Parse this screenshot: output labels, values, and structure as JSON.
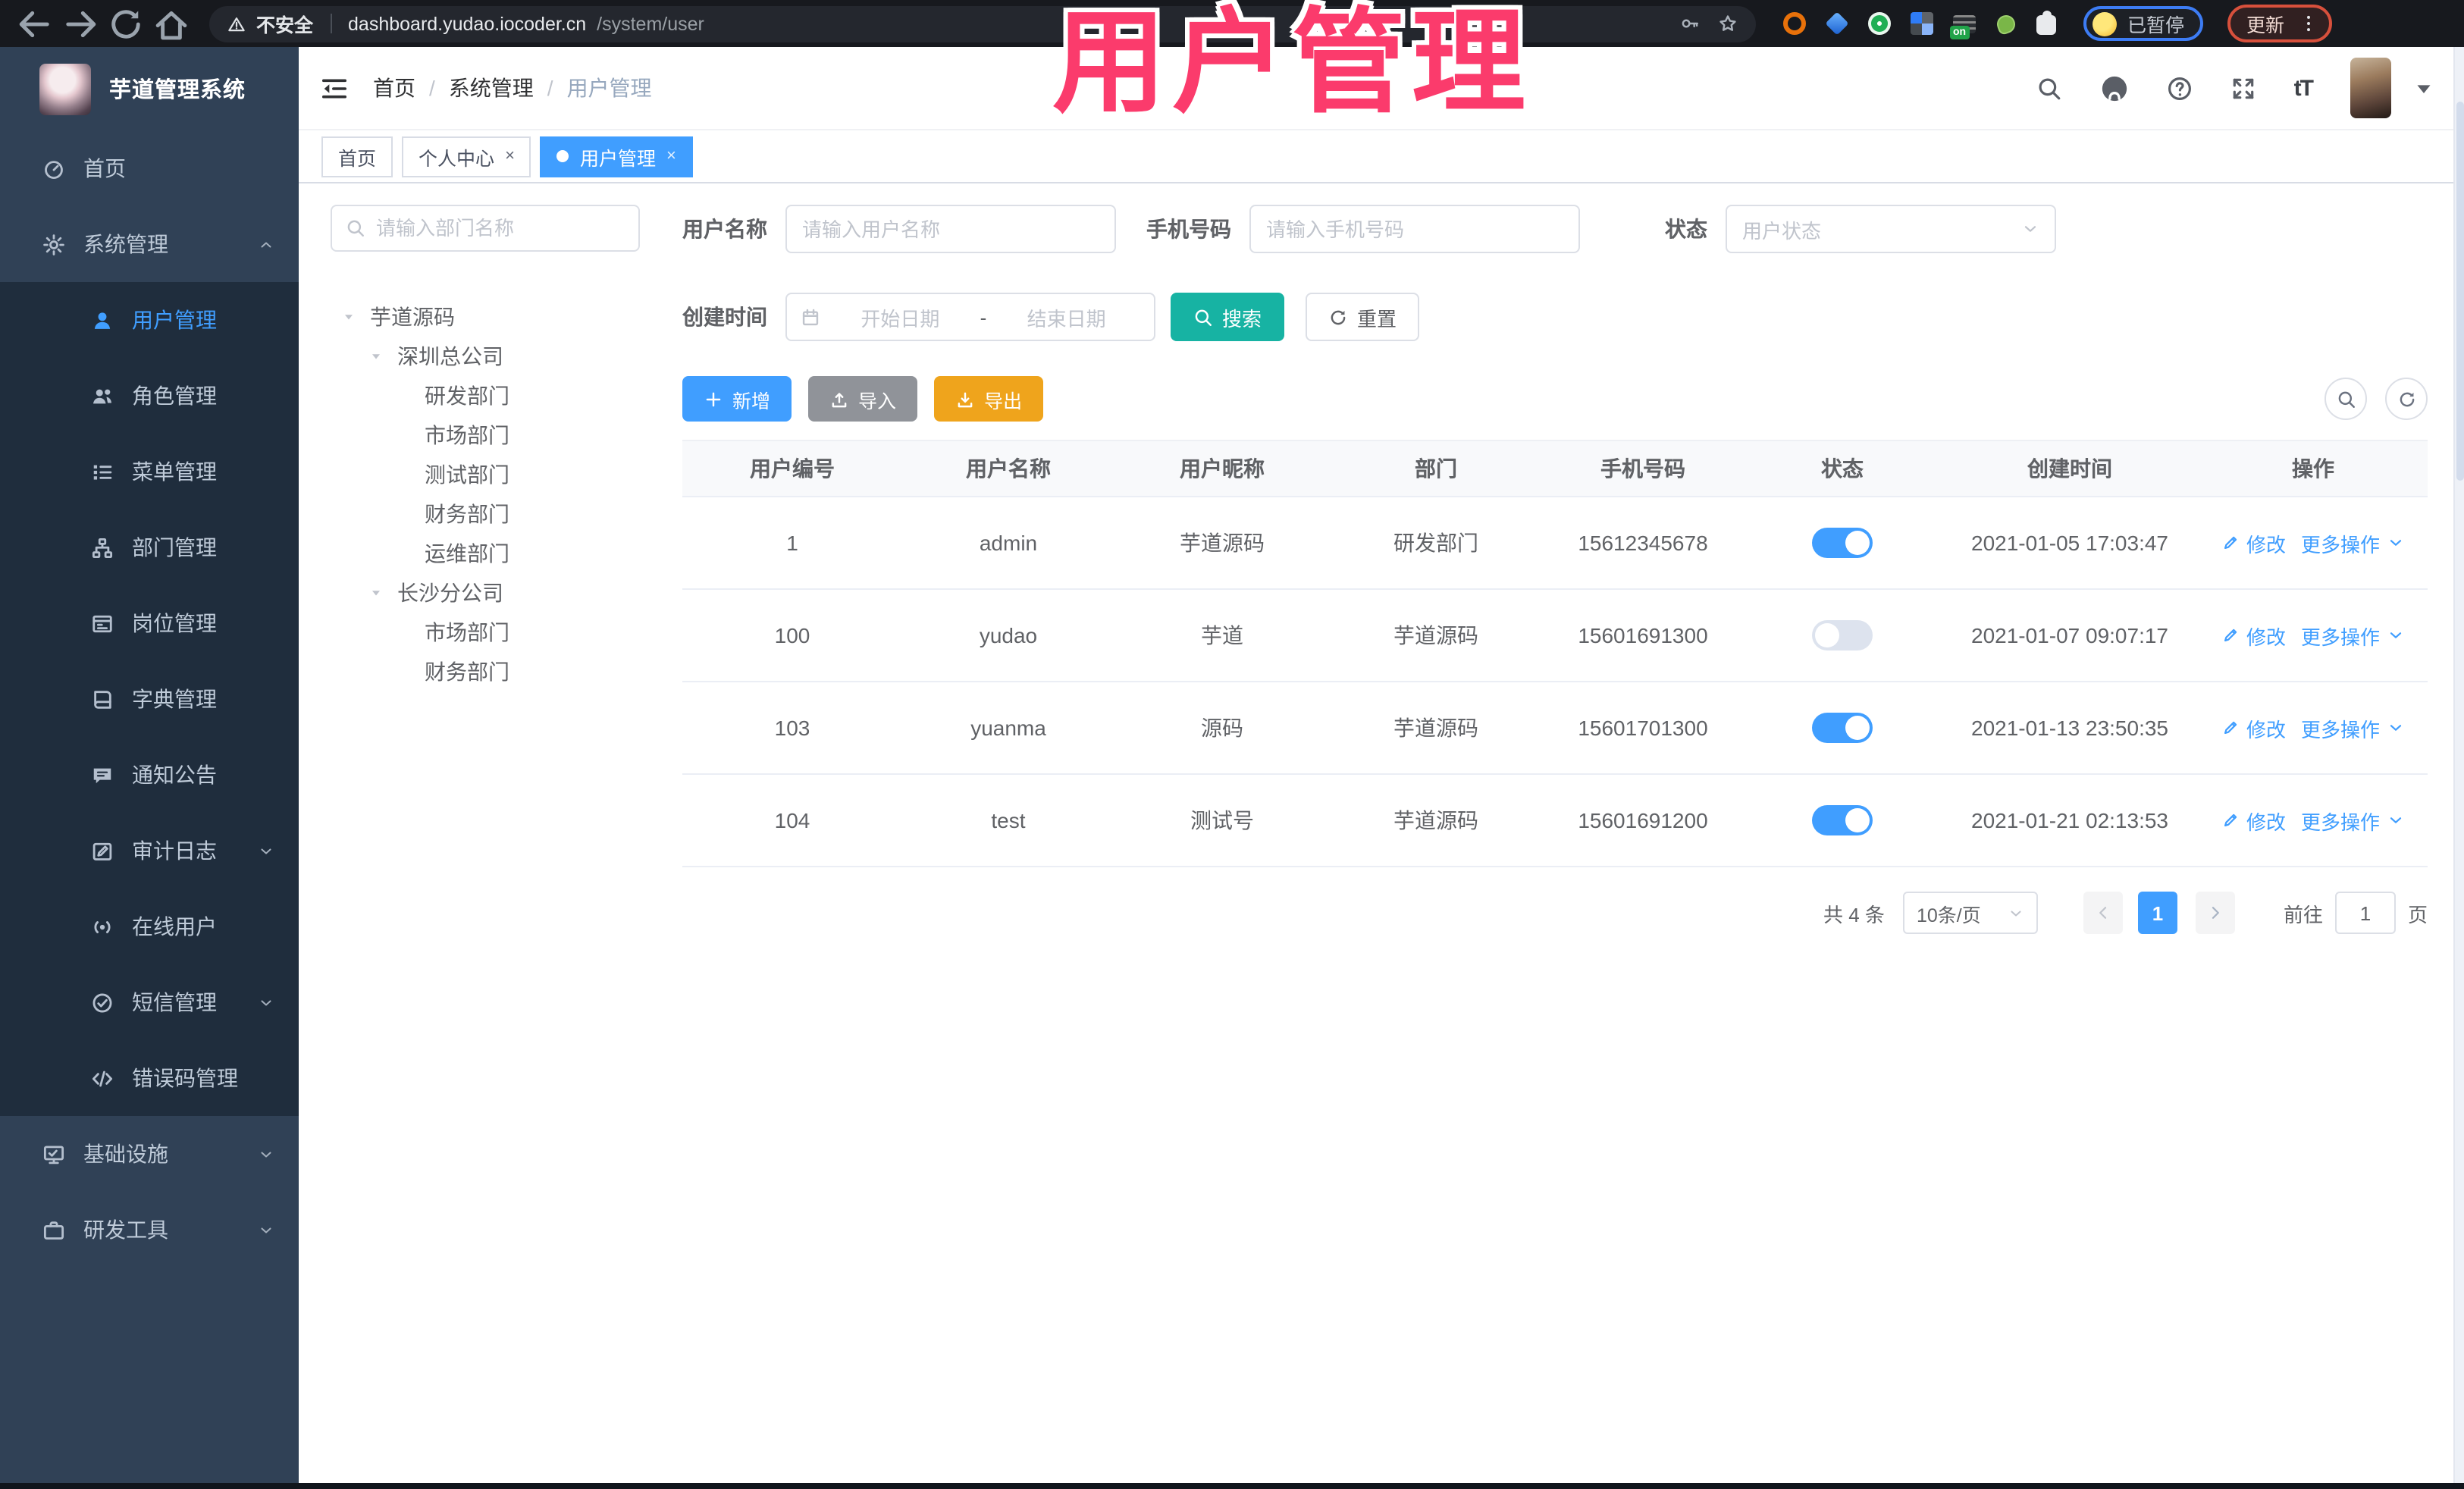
{
  "browser": {
    "security_label": "不安全",
    "url_host": "dashboard.yudao.iocoder.cn",
    "url_path": "/system/user",
    "paused_label": "已暂停",
    "update_label": "更新"
  },
  "annotation": {
    "text": "用户管理"
  },
  "app": {
    "logo_title": "芋道管理系统",
    "breadcrumb": [
      "首页",
      "系统管理",
      "用户管理"
    ],
    "tabs": [
      {
        "label": "首页",
        "closable": false,
        "active": false
      },
      {
        "label": "个人中心",
        "closable": true,
        "active": false
      },
      {
        "label": "用户管理",
        "closable": true,
        "active": true
      }
    ]
  },
  "sidebar": {
    "items": [
      {
        "label": "首页",
        "icon": "dashboard",
        "level": "top"
      },
      {
        "label": "系统管理",
        "icon": "gear",
        "level": "top",
        "chevron": "up"
      },
      {
        "label": "用户管理",
        "icon": "user",
        "level": "sub",
        "active": true
      },
      {
        "label": "角色管理",
        "icon": "users",
        "level": "sub"
      },
      {
        "label": "菜单管理",
        "icon": "menu-tree",
        "level": "sub"
      },
      {
        "label": "部门管理",
        "icon": "org",
        "level": "sub"
      },
      {
        "label": "岗位管理",
        "icon": "badge",
        "level": "sub"
      },
      {
        "label": "字典管理",
        "icon": "dictionary",
        "level": "sub"
      },
      {
        "label": "通知公告",
        "icon": "announcement",
        "level": "sub"
      },
      {
        "label": "审计日志",
        "icon": "audit",
        "level": "sub",
        "chevron": "down"
      },
      {
        "label": "在线用户",
        "icon": "online",
        "level": "sub"
      },
      {
        "label": "短信管理",
        "icon": "sms",
        "level": "sub",
        "chevron": "down"
      },
      {
        "label": "错误码管理",
        "icon": "code",
        "level": "sub"
      },
      {
        "label": "基础设施",
        "icon": "infra",
        "level": "top",
        "chevron": "down"
      },
      {
        "label": "研发工具",
        "icon": "tools",
        "level": "top",
        "chevron": "down"
      }
    ]
  },
  "tree": {
    "search_placeholder": "请输入部门名称",
    "nodes": [
      {
        "label": "芋道源码",
        "indent": 0,
        "caret": true
      },
      {
        "label": "深圳总公司",
        "indent": 1,
        "caret": true
      },
      {
        "label": "研发部门",
        "indent": 2,
        "caret": false
      },
      {
        "label": "市场部门",
        "indent": 2,
        "caret": false
      },
      {
        "label": "测试部门",
        "indent": 2,
        "caret": false
      },
      {
        "label": "财务部门",
        "indent": 2,
        "caret": false
      },
      {
        "label": "运维部门",
        "indent": 2,
        "caret": false
      },
      {
        "label": "长沙分公司",
        "indent": 1,
        "caret": true
      },
      {
        "label": "市场部门",
        "indent": 2,
        "caret": false
      },
      {
        "label": "财务部门",
        "indent": 2,
        "caret": false
      }
    ]
  },
  "filters": {
    "username_label": "用户名称",
    "username_placeholder": "请输入用户名称",
    "mobile_label": "手机号码",
    "mobile_placeholder": "请输入手机号码",
    "status_label": "状态",
    "status_placeholder": "用户状态",
    "created_label": "创建时间",
    "date_start_placeholder": "开始日期",
    "date_separator": "-",
    "date_end_placeholder": "结束日期",
    "search_label": "搜索",
    "reset_label": "重置"
  },
  "toolbar": {
    "add_label": "新增",
    "import_label": "导入",
    "export_label": "导出"
  },
  "table": {
    "columns": [
      "用户编号",
      "用户名称",
      "用户昵称",
      "部门",
      "手机号码",
      "状态",
      "创建时间",
      "操作"
    ],
    "edit_label": "修改",
    "more_label": "更多操作",
    "rows": [
      {
        "id": "1",
        "username": "admin",
        "nickname": "芋道源码",
        "dept": "研发部门",
        "mobile": "15612345678",
        "status_on": true,
        "created": "2021-01-05 17:03:47"
      },
      {
        "id": "100",
        "username": "yudao",
        "nickname": "芋道",
        "dept": "芋道源码",
        "mobile": "15601691300",
        "status_on": false,
        "created": "2021-01-07 09:07:17"
      },
      {
        "id": "103",
        "username": "yuanma",
        "nickname": "源码",
        "dept": "芋道源码",
        "mobile": "15601701300",
        "status_on": true,
        "created": "2021-01-13 23:50:35"
      },
      {
        "id": "104",
        "username": "test",
        "nickname": "测试号",
        "dept": "芋道源码",
        "mobile": "15601691200",
        "status_on": true,
        "created": "2021-01-21 02:13:53"
      }
    ]
  },
  "pagination": {
    "total_label": "共 4 条",
    "page_size": "10条/页",
    "current_page": "1",
    "goto_label": "前往",
    "goto_value": "1",
    "page_label": "页"
  },
  "colors": {
    "primary": "#409eff",
    "teal": "#17b3a3",
    "warning": "#efa41c",
    "info_gray": "#909399",
    "sidebar_bg": "#304156",
    "submenu_bg": "#1f2d3d",
    "annotation": "#fb3b6c",
    "browser_bar": "#17191e"
  }
}
